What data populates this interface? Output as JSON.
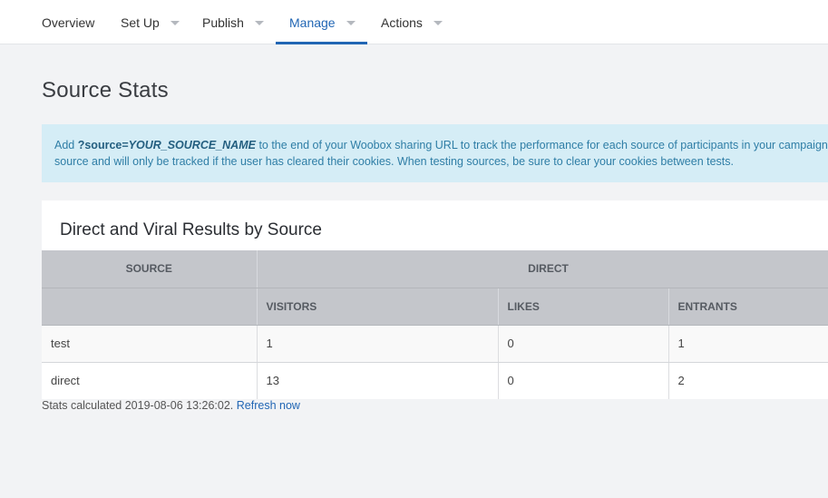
{
  "nav": {
    "items": [
      {
        "label": "Overview"
      },
      {
        "label": "Set Up"
      },
      {
        "label": "Publish"
      },
      {
        "label": "Manage"
      },
      {
        "label": "Actions"
      }
    ],
    "active": "Manage"
  },
  "page": {
    "title": "Source Stats"
  },
  "info": {
    "prefix": "Add ",
    "param": "?source=",
    "param_value": "YOUR_SOURCE_NAME",
    "line1_rest": " to the end of your Woobox sharing URL to track the performance for each source of participants in your campaign.",
    "line2": "source and will only be tracked if the user has cleared their cookies. When testing sources, be sure to clear your cookies between tests."
  },
  "panel": {
    "title": "Direct and Viral Results by Source",
    "header_groups": {
      "source": "SOURCE",
      "direct": "DIRECT"
    },
    "columns": [
      "VISITORS",
      "LIKES",
      "ENTRANTS"
    ],
    "rows": [
      {
        "source": "test",
        "visitors": "1",
        "likes": "0",
        "entrants": "1"
      },
      {
        "source": "direct",
        "visitors": "13",
        "likes": "0",
        "entrants": "2"
      }
    ]
  },
  "footer": {
    "text": "Stats calculated 2019-08-06 13:26:02.",
    "link": "Refresh now"
  }
}
